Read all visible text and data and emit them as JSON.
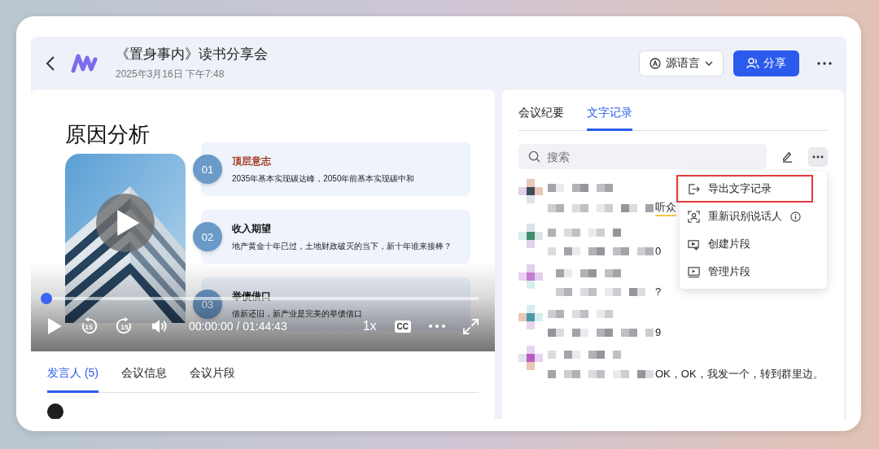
{
  "header": {
    "title": "《置身事内》读书分享会",
    "date": "2025年3月16日 下午7:48",
    "language_button": "源语言",
    "share_button": "分享"
  },
  "video": {
    "slide": {
      "title": "原因分析",
      "items": [
        {
          "number": "01",
          "heading": "顶层意志",
          "accent": true,
          "text": "2035年基本实现碳达峰，2050年前基本实现碳中和"
        },
        {
          "number": "02",
          "heading": "收入期望",
          "accent": false,
          "text": "地产黄金十年已过，土地财政破灭的当下，新十年谁来接棒？"
        },
        {
          "number": "03",
          "heading": "举债借口",
          "accent": false,
          "text": "借新还旧，新产业是完美的举债借口"
        }
      ]
    },
    "player": {
      "playing": false,
      "level": 0,
      "time": "00:00:00 / 01:44:43",
      "speed": "1x",
      "captions": "CC",
      "skip_back": "15",
      "skip_forward": "15"
    }
  },
  "bottom_tabs": [
    {
      "label": "发言人 (5)",
      "selected": true
    },
    {
      "label": "会议信息",
      "selected": false
    },
    {
      "label": "会议片段",
      "selected": false
    }
  ],
  "right_tabs": [
    {
      "label": "会议纪要",
      "selected": false
    },
    {
      "label": "文字记录",
      "selected": true
    }
  ],
  "search": {
    "placeholder": "搜索"
  },
  "menu": [
    {
      "label": "导出文字记录",
      "kind": "export",
      "highlighted": true,
      "info": false
    },
    {
      "label": "重新识别说话人",
      "kind": "speaker",
      "highlighted": false,
      "info": true
    },
    {
      "label": "创建片段",
      "kind": "create",
      "highlighted": false,
      "info": false
    },
    {
      "label": "管理片段",
      "kind": "manage",
      "highlighted": false,
      "info": false
    }
  ],
  "transcript": [
    {
      "color": "#3d4f57",
      "tail": "听众",
      "marked": true
    },
    {
      "color": "#3f8f6e",
      "tail": "0",
      "marked": false
    },
    {
      "color": "#c57ad6",
      "tail": "?",
      "marked": false
    },
    {
      "color": "#4a9aa6",
      "tail": "9",
      "marked": false
    },
    {
      "color": "#b75cc4",
      "tail": "OK，OK，我发一个，转到群里边。",
      "marked": false
    }
  ]
}
